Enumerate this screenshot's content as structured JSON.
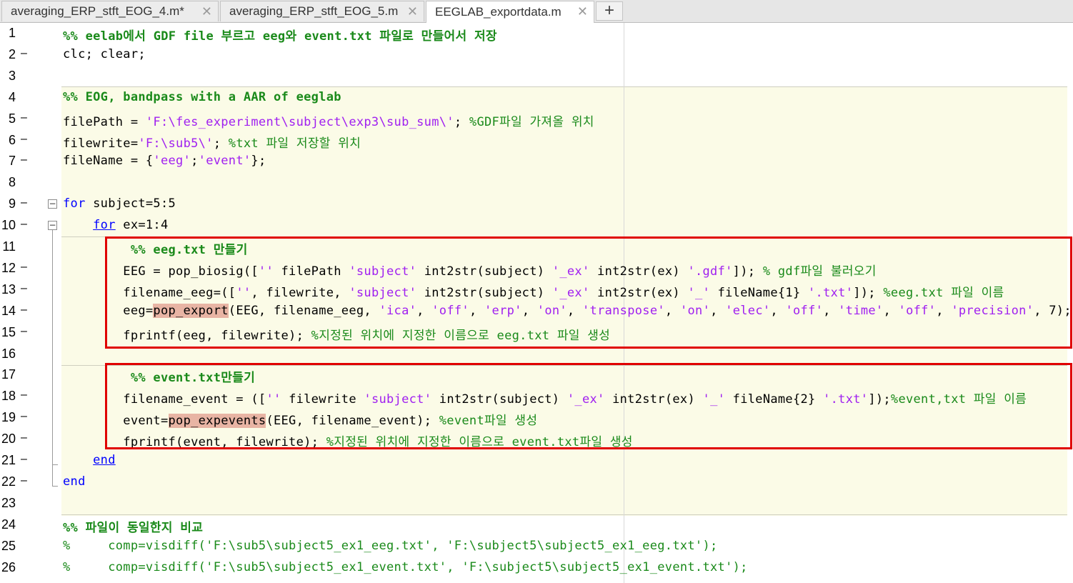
{
  "tabs": [
    {
      "label": "averaging_ERP_stft_EOG_4.m*",
      "close": "✕"
    },
    {
      "label": "averaging_ERP_stft_EOG_5.m",
      "close": "✕"
    },
    {
      "label": "EEGLAB_exportdata.m",
      "close": "✕"
    }
  ],
  "add_tab_label": "+",
  "colors": {
    "comment": "#1a8a1a",
    "string": "#a020f0",
    "keyword": "#0000ff",
    "annotation_box": "#e00000",
    "cell_band": "#fbfbe7",
    "highlight": "#e8b4a4"
  },
  "lines": [
    {
      "n": "1",
      "bp": "",
      "tokens": [
        [
          "cell",
          "%% eelab에서 GDF file 부르고 eeg와 event.txt 파일로 만들어서 저장"
        ]
      ]
    },
    {
      "n": "2",
      "bp": "–",
      "tokens": [
        [
          "plain",
          "clc; clear;"
        ]
      ]
    },
    {
      "n": "3",
      "bp": "",
      "tokens": []
    },
    {
      "n": "4",
      "bp": "",
      "tokens": [
        [
          "cell",
          "%% EOG, bandpass with a AAR of eeglab"
        ]
      ]
    },
    {
      "n": "5",
      "bp": "–",
      "tokens": [
        [
          "plain",
          "filePath = "
        ],
        [
          "string",
          "'F:\\fes_experiment\\subject\\exp3\\sub_sum\\'"
        ],
        [
          "plain",
          "; "
        ],
        [
          "comment",
          "%GDF파일 가져올 위치"
        ]
      ]
    },
    {
      "n": "6",
      "bp": "–",
      "tokens": [
        [
          "plain",
          "filewrite="
        ],
        [
          "string",
          "'F:\\sub5\\'"
        ],
        [
          "plain",
          "; "
        ],
        [
          "comment",
          "%txt 파일 저장할 위치"
        ]
      ]
    },
    {
      "n": "7",
      "bp": "–",
      "tokens": [
        [
          "plain",
          "fileName = {"
        ],
        [
          "string",
          "'eeg'"
        ],
        [
          "plain",
          ";"
        ],
        [
          "string",
          "'event'"
        ],
        [
          "plain",
          "};"
        ]
      ]
    },
    {
      "n": "8",
      "bp": "",
      "tokens": []
    },
    {
      "n": "9",
      "bp": "–",
      "tokens": [
        [
          "keyword",
          "for"
        ],
        [
          "plain",
          " subject=5:5"
        ]
      ]
    },
    {
      "n": "10",
      "bp": "–",
      "tokens": [
        [
          "plain",
          "    "
        ],
        [
          "keyword_u",
          "for"
        ],
        [
          "plain",
          " ex=1:4"
        ]
      ]
    },
    {
      "n": "11",
      "bp": "",
      "tokens": [
        [
          "plain",
          "         "
        ],
        [
          "cell",
          "%% eeg.txt 만들기"
        ]
      ]
    },
    {
      "n": "12",
      "bp": "–",
      "tokens": [
        [
          "plain",
          "        EEG = pop_biosig(["
        ],
        [
          "string",
          "''"
        ],
        [
          "plain",
          " filePath "
        ],
        [
          "string",
          "'subject'"
        ],
        [
          "plain",
          " int2str(subject) "
        ],
        [
          "string",
          "'_ex'"
        ],
        [
          "plain",
          " int2str(ex) "
        ],
        [
          "string",
          "'.gdf'"
        ],
        [
          "plain",
          "]); "
        ],
        [
          "comment",
          "% gdf파일 불러오기"
        ]
      ]
    },
    {
      "n": "13",
      "bp": "–",
      "tokens": [
        [
          "plain",
          "        filename_eeg=(["
        ],
        [
          "string",
          "''"
        ],
        [
          "plain",
          ", filewrite, "
        ],
        [
          "string",
          "'subject'"
        ],
        [
          "plain",
          " int2str(subject) "
        ],
        [
          "string",
          "'_ex'"
        ],
        [
          "plain",
          " int2str(ex) "
        ],
        [
          "string",
          "'_'"
        ],
        [
          "plain",
          " fileName{1} "
        ],
        [
          "string",
          "'.txt'"
        ],
        [
          "plain",
          "]); "
        ],
        [
          "comment",
          "%eeg.txt 파일 이름"
        ]
      ]
    },
    {
      "n": "14",
      "bp": "–",
      "tokens": [
        [
          "plain",
          "        eeg="
        ],
        [
          "hl",
          "pop_export"
        ],
        [
          "plain",
          "(EEG, filename_eeg, "
        ],
        [
          "string",
          "'ica'"
        ],
        [
          "plain",
          ", "
        ],
        [
          "string",
          "'off'"
        ],
        [
          "plain",
          ", "
        ],
        [
          "string",
          "'erp'"
        ],
        [
          "plain",
          ", "
        ],
        [
          "string",
          "'on'"
        ],
        [
          "plain",
          ", "
        ],
        [
          "string",
          "'transpose'"
        ],
        [
          "plain",
          ", "
        ],
        [
          "string",
          "'on'"
        ],
        [
          "plain",
          ", "
        ],
        [
          "string",
          "'elec'"
        ],
        [
          "plain",
          ", "
        ],
        [
          "string",
          "'off'"
        ],
        [
          "plain",
          ", "
        ],
        [
          "string",
          "'time'"
        ],
        [
          "plain",
          ", "
        ],
        [
          "string",
          "'off'"
        ],
        [
          "plain",
          ", "
        ],
        [
          "string",
          "'precision'"
        ],
        [
          "plain",
          ", 7);"
        ]
      ]
    },
    {
      "n": "15",
      "bp": "–",
      "tokens": [
        [
          "plain",
          "        fprintf(eeg, filewrite); "
        ],
        [
          "comment",
          "%지정된 위치에 지정한 이름으로 eeg.txt 파일 생성"
        ]
      ]
    },
    {
      "n": "16",
      "bp": "",
      "tokens": []
    },
    {
      "n": "17",
      "bp": "",
      "tokens": [
        [
          "plain",
          "         "
        ],
        [
          "cell",
          "%% event.txt만들기"
        ]
      ]
    },
    {
      "n": "18",
      "bp": "–",
      "tokens": [
        [
          "plain",
          "        filename_event = (["
        ],
        [
          "string",
          "''"
        ],
        [
          "plain",
          " filewrite "
        ],
        [
          "string",
          "'subject'"
        ],
        [
          "plain",
          " int2str(subject) "
        ],
        [
          "string",
          "'_ex'"
        ],
        [
          "plain",
          " int2str(ex) "
        ],
        [
          "string",
          "'_'"
        ],
        [
          "plain",
          " fileName{2} "
        ],
        [
          "string",
          "'.txt'"
        ],
        [
          "plain",
          "]);"
        ],
        [
          "comment",
          "%event,txt 파일 이름"
        ]
      ]
    },
    {
      "n": "19",
      "bp": "–",
      "tokens": [
        [
          "plain",
          "        event="
        ],
        [
          "hl",
          "pop_expevents"
        ],
        [
          "plain",
          "(EEG, filename_event); "
        ],
        [
          "comment",
          "%event파일 생성"
        ]
      ]
    },
    {
      "n": "20",
      "bp": "–",
      "tokens": [
        [
          "plain",
          "        fprintf(event, filewrite); "
        ],
        [
          "comment",
          "%지정된 위치에 지정한 이름으로 event.txt파일 생성"
        ]
      ]
    },
    {
      "n": "21",
      "bp": "–",
      "tokens": [
        [
          "plain",
          "    "
        ],
        [
          "keyword_u",
          "end"
        ]
      ]
    },
    {
      "n": "22",
      "bp": "–",
      "tokens": [
        [
          "keyword",
          "end"
        ]
      ]
    },
    {
      "n": "23",
      "bp": "",
      "tokens": []
    },
    {
      "n": "24",
      "bp": "",
      "tokens": [
        [
          "cell",
          "%% 파일이 동일한지 비교"
        ]
      ]
    },
    {
      "n": "25",
      "bp": "",
      "tokens": [
        [
          "comment",
          "%     comp=visdiff('F:\\sub5\\subject5_ex1_eeg.txt', 'F:\\subject5\\subject5_ex1_eeg.txt');"
        ]
      ]
    },
    {
      "n": "26",
      "bp": "",
      "tokens": [
        [
          "comment",
          "%     comp=visdiff('F:\\sub5\\subject5_ex1_event.txt', 'F:\\subject5\\subject5_ex1_event.txt');"
        ]
      ]
    }
  ]
}
